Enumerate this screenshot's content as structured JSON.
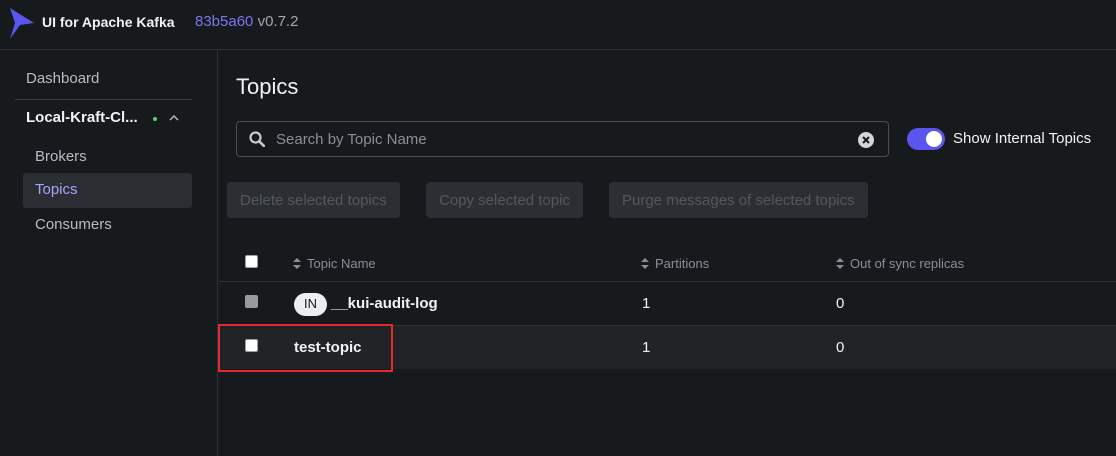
{
  "header": {
    "app_title": "UI for Apache Kafka",
    "version_hash": "83b5a60",
    "version": "v0.7.2",
    "logo_icon": "kafka-ui-logo-icon"
  },
  "sidebar": {
    "dashboard": "Dashboard",
    "cluster_name": "Local-Kraft-Cl...",
    "cluster_status": "online",
    "items": [
      {
        "label": "Brokers",
        "active": false
      },
      {
        "label": "Topics",
        "active": true
      },
      {
        "label": "Consumers",
        "active": false
      }
    ]
  },
  "main": {
    "title": "Topics",
    "search": {
      "placeholder": "Search by Topic Name",
      "value": ""
    },
    "show_internal": {
      "label": "Show Internal Topics",
      "checked": true
    },
    "actions": {
      "delete": "Delete selected topics",
      "copy": "Copy selected topic",
      "purge": "Purge messages of selected topics"
    },
    "table": {
      "columns": [
        "Topic Name",
        "Partitions",
        "Out of sync replicas"
      ],
      "rows": [
        {
          "badge": "IN",
          "name": "__kui-audit-log",
          "partitions": "1",
          "out_of_sync": "0",
          "selectable": false
        },
        {
          "badge": "",
          "name": "test-topic",
          "partitions": "1",
          "out_of_sync": "0",
          "selectable": true
        }
      ]
    }
  },
  "colors": {
    "accent": "#5b55ef",
    "active_nav": "#a7a3ff",
    "status_dot": "#5fd072",
    "highlight_box": "#e22a2a"
  }
}
